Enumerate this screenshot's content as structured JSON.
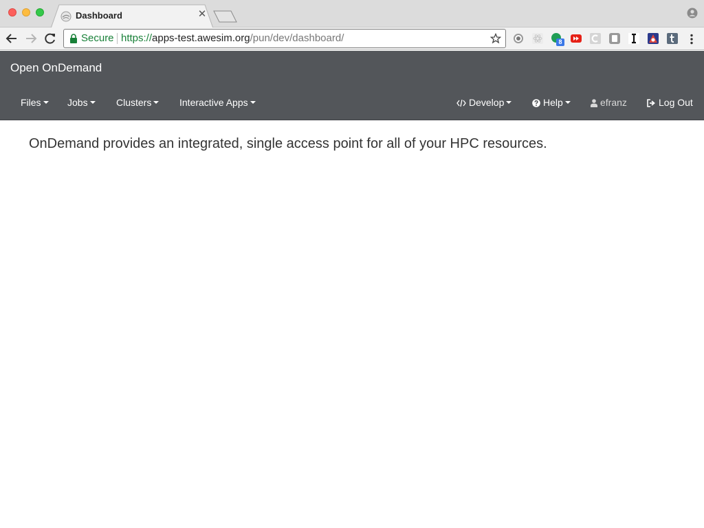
{
  "browser": {
    "tab": {
      "title": "Dashboard"
    },
    "address_bar": {
      "security_label": "Secure",
      "url_scheme": "https://",
      "url_host": "apps-test.awesim.org",
      "url_path": "/pun/dev/dashboard/"
    },
    "extensions": [
      {
        "icon": "gear-extension-icon"
      },
      {
        "icon": "react-devtools-icon"
      },
      {
        "icon": "green-dot-extension-icon",
        "badge": "8"
      },
      {
        "icon": "youtube-extension-icon"
      },
      {
        "icon": "c-extension-icon"
      },
      {
        "icon": "note-extension-icon"
      },
      {
        "icon": "instapaper-icon"
      },
      {
        "icon": "postman-icon"
      },
      {
        "icon": "tumblr-icon"
      }
    ],
    "colors": {
      "secure_green": "#188038",
      "tab_strip": "#dcdcdc",
      "toolbar": "#f2f2f2"
    }
  },
  "app": {
    "brand": "Open OnDemand",
    "nav_left": [
      {
        "label": "Files"
      },
      {
        "label": "Jobs"
      },
      {
        "label": "Clusters"
      },
      {
        "label": "Interactive Apps"
      }
    ],
    "nav_right": {
      "develop": "Develop",
      "help": "Help",
      "user": "efranz",
      "logout": "Log Out"
    },
    "colors": {
      "navbar": "#53565a"
    }
  },
  "main": {
    "tagline": "OnDemand provides an integrated, single access point for all of your HPC resources."
  }
}
